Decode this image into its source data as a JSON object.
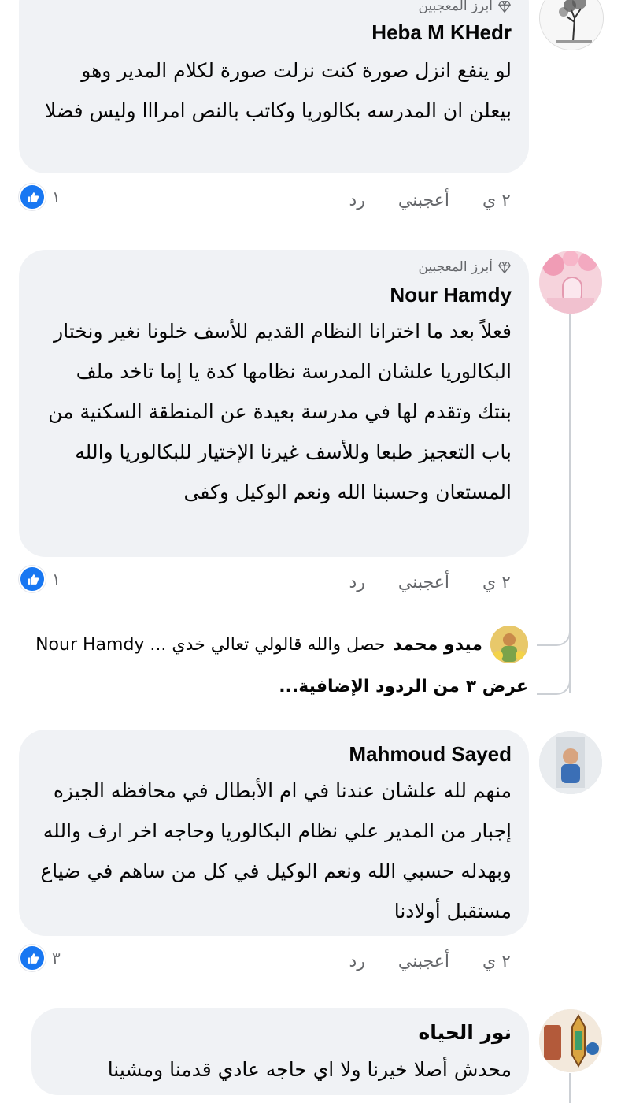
{
  "comments": [
    {
      "badge": "أبرز المعجبين",
      "author": "Heba M KHedr",
      "text": "لو ينفع انزل صورة كنت نزلت صورة لكلام المدير وهو بيعلن ان المدرسه بكالوريا وكاتب بالنص امرااا وليس فضلا",
      "time": "٢ ي",
      "like_label": "أعجبني",
      "reply_label": "رد",
      "reaction_count": "١"
    },
    {
      "badge": "أبرز المعجبين",
      "author": "Nour Hamdy",
      "text": "فعلاً بعد ما اخترانا النظام القديم للأسف خلونا نغير ونختار البكالوريا علشان المدرسة نظامها كدة يا إما تاخد ملف بنتك وتقدم لها في مدرسة بعيدة عن المنطقة السكنية من باب التعجيز طبعا وللأسف غيرنا الإختيار للبكالوريا والله المستعان وحسبنا الله ونعم الوكيل وكفى",
      "time": "٢ ي",
      "like_label": "أعجبني",
      "reply_label": "رد",
      "reaction_count": "١",
      "reply_preview": {
        "author": "ميدو محمد",
        "text": "حصل والله قالولي تعالي خدي ... Nour Hamdy"
      },
      "more_replies": "عرض ٣ من الردود الإضافية..."
    },
    {
      "author": "Mahmoud Sayed",
      "text": "منهم لله علشان عندنا في ام الأبطال في محافظه الجيزه إجبار من المدير علي نظام البكالوريا وحاجه اخر ارف والله وبهدله حسبي الله ونعم الوكيل في كل من ساهم في ضياع مستقبل أولادنا",
      "time": "٢ ي",
      "like_label": "أعجبني",
      "reply_label": "رد",
      "reaction_count": "٣"
    },
    {
      "author": "نور الحياه",
      "text": "محدش أصلا خيرنا ولا اي حاجه عادي قدمنا ومشينا"
    }
  ],
  "icons": {
    "badge": "diamond-icon",
    "reaction": "like-thumb-icon"
  },
  "colors": {
    "bubble": "#f0f2f5",
    "like_blue": "#1877f2",
    "meta_gray": "#65676b"
  }
}
